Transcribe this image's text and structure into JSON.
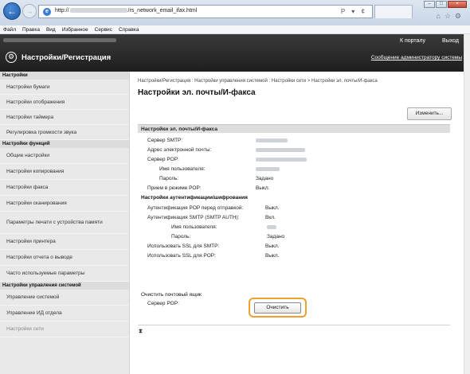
{
  "browser": {
    "url_prefix": "http://",
    "url_suffix": "/rs_network_email_ifax.html",
    "address_tools": "P ▾ ¢",
    "icons": [
      "home-icon",
      "star-icon",
      "gear-icon"
    ]
  },
  "menu": [
    "Файл",
    "Правка",
    "Вид",
    "Избранное",
    "Сервис",
    "Справка"
  ],
  "header": {
    "portal": "К порталу",
    "logout": "Выход",
    "title": "Настройки/Регистрация",
    "admin_message": "Сообщение администратору системы"
  },
  "sidebar": {
    "section1": "Настройки",
    "items1": [
      "Настройки бумаги",
      "Настройки отображения",
      "Настройки таймера",
      "Регулировка громкости звука"
    ],
    "section2": "Настройки функций",
    "items2": [
      "Общие настройки",
      "Настройки копирования",
      "Настройки факса",
      "Настройки сканирования",
      "Параметры печати с устройства памяти",
      "Настройки принтера",
      "Настройки отчета о выводе",
      "Часто используемые параметры"
    ],
    "section3": "Настройки управления системой",
    "items3": [
      "Управление системой",
      "Управление ИД отдела",
      "Настройки сети"
    ]
  },
  "main": {
    "breadcrumb": "Настройки/Регистрация : Настройки управления системой : Настройки сети > Настройки эл. почты/И-факса",
    "title": "Настройки эл. почты/И-факса",
    "edit_button": "Изменить...",
    "panel_header": "Настройки эл. почты/И-факса",
    "smtp_server": "Сервер SMTP:",
    "email_address": "Адрес электронной почты:",
    "pop_server": "Сервер POP:",
    "username": "Имя пользователя:",
    "password": "Пароль:",
    "password_value": "Задано",
    "pop_receive": "Прием в режиме POP:",
    "pop_receive_value": "Выкл.",
    "auth_header": "Настройки аутентификации/шифрования",
    "pop_before_smtp": "Аутентификация POP перед отправкой:",
    "pop_before_smtp_value": "Выкл.",
    "smtp_auth": "Аутентификация SMTP (SMTP AUTH):",
    "smtp_auth_value": "Вкл.",
    "username2": "Имя пользователя:",
    "password2": "Пароль:",
    "password2_value": "Задано",
    "ssl_smtp": "Использовать SSL для SMTP:",
    "ssl_smtp_value": "Выкл.",
    "ssl_pop": "Использовать SSL для POP:",
    "ssl_pop_value": "Выкл.",
    "clear_mailbox": "Очистить почтовый ящик",
    "clear_pop": "Сервер POP:",
    "clear_button": "Очистить",
    "to_top": "⧗"
  }
}
